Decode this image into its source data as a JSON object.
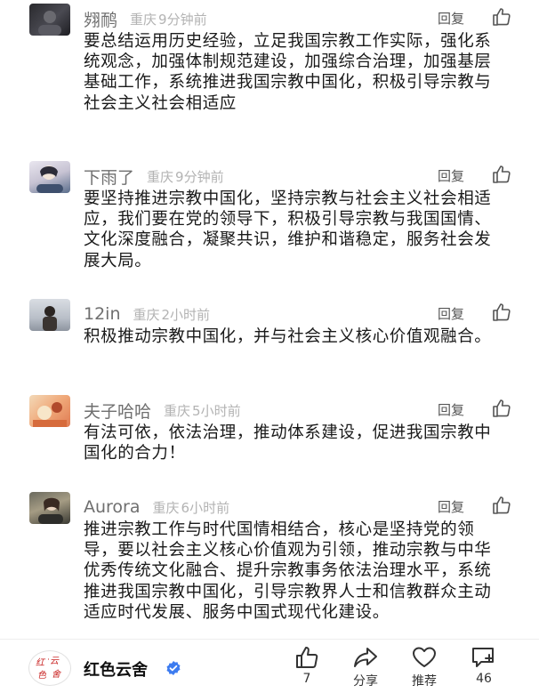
{
  "comments": [
    {
      "username": "翙鸸",
      "location": "重庆",
      "time": "9分钟前",
      "reply_label": "回复",
      "content": "要总结运用历史经验，立足我国宗教工作实际，强化系统观念，加强体制规范建设，加强综合治理，加强基层基础工作，系统推进我国宗教中国化，积极引导宗教与社会主义社会相适应"
    },
    {
      "username": "下雨了",
      "location": "重庆",
      "time": "9分钟前",
      "reply_label": "回复",
      "content": "要坚持推进宗教中国化，坚持宗教与社会主义社会相适应，我们要在党的领导下，积极引导宗教与我国国情、文化深度融合，凝聚共识，维护和谐稳定，服务社会发展大局。"
    },
    {
      "username": "12in",
      "location": "重庆",
      "time": "2小时前",
      "reply_label": "回复",
      "content": "积极推动宗教中国化，并与社会主义核心价值观融合。"
    },
    {
      "username": "夫子哈哈",
      "location": "重庆",
      "time": "5小时前",
      "reply_label": "回复",
      "content": "有法可依，依法治理，推动体系建设，促进我国宗教中国化的合力！"
    },
    {
      "username": "Aurora",
      "location": "重庆",
      "time": "6小时前",
      "reply_label": "回复",
      "content": "推进宗教工作与时代国情相结合，核心是坚持党的领导，要以社会主义核心价值观为引领，推动宗教与中华优秀传统文化融合、提升宗教事务依法治理水平，系统推进我国宗教中国化，引导宗教界人士和信教群众主动适应时代发展、服务中国式现代化建设。"
    }
  ],
  "bottom_bar": {
    "brand_name": "红色云舍",
    "logo_text": "红色云舍",
    "like_count": "7",
    "share_label": "分享",
    "recommend_label": "推荐",
    "comment_count": "46"
  },
  "colors": {
    "verified_blue": "#3d7cf0",
    "logo_red": "#c8201f"
  }
}
